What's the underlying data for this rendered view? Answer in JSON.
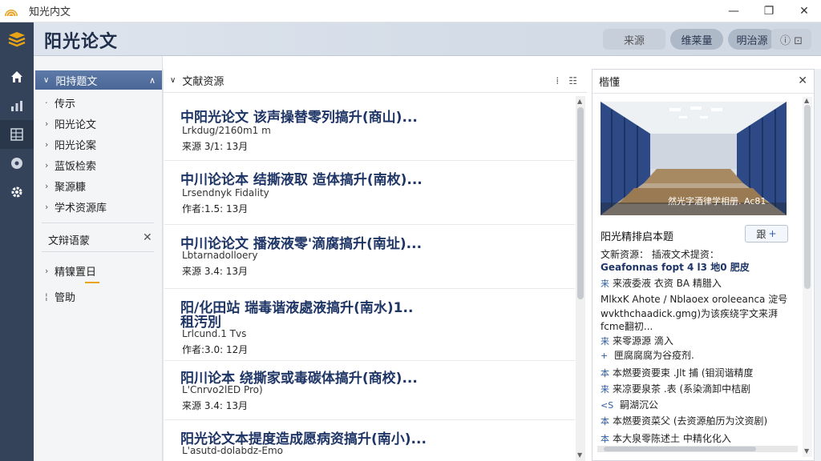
{
  "window": {
    "app_name": "知光内文",
    "min_glyph": "—",
    "max_glyph": "❐",
    "close_glyph": "✕"
  },
  "header": {
    "title": "阳光论文",
    "buttons": [
      {
        "label": "来源"
      },
      {
        "label": "维莱量"
      },
      {
        "label": "明治源"
      }
    ],
    "icon_button": "ⓘ ⊡"
  },
  "rail": {
    "icons": [
      "home-icon",
      "chart-icon",
      "grid-icon",
      "compass-icon",
      "gear-icon"
    ]
  },
  "nav": {
    "head_label": "阳持题文",
    "items": [
      "传示",
      "阳光论文",
      "阳光论案",
      "蓝饭检索",
      "聚源糠",
      "学术资源库"
    ],
    "section_label": "文辩语蒙",
    "section_items": [
      "精镍置日",
      "管助"
    ]
  },
  "list": {
    "header": "文献资源",
    "results": [
      {
        "title": "中阳光论文  该声操替零列搞升(商山)...",
        "sub": "Lrkdug/2160m1 m",
        "meta": "来源 3/1: 13月"
      },
      {
        "title": "中川论论本  结撕液取  造体搞升(南枚)...",
        "sub": "Lrsendnyk Fidality",
        "meta": "作者:1.5: 13月"
      },
      {
        "title": "中川论论文  播液液零'滴腐搞升(南址)...",
        "sub": "Lbtarnadolloery",
        "meta": "来源 3.4: 13月"
      },
      {
        "title": "阳/化田站  瑞毒谐液處液搞升(南水)1..",
        "title2": "租汚別",
        "sub": "Lrlcund.1 Tvs",
        "meta": "作者:3.0: 12月"
      },
      {
        "title": "阳川论本  绕撕家或毒碳体搞升(商校)...",
        "sub": "L'Cnrvo2lED Pro)",
        "meta": "来源 3.4: 13月"
      },
      {
        "title": "阳光论文本提度造成愿病资搞升(南小)...",
        "sub": "L'asutd-dolabdz-Emo",
        "meta": ""
      }
    ]
  },
  "detail": {
    "header": "楷懂",
    "photo_caption": "然光字酒律学相册. Ac81",
    "title": "阳光精排启本题",
    "action_label": "跟",
    "lines": [
      {
        "text": "文新资源：  插液文术提资：",
        "style": "plain"
      },
      {
        "text": "Geafonnas fopt 4 l3 地0 肥皮",
        "style": "bold"
      },
      {
        "icon": "来",
        "text": "来液委液  衣资 BA 精腊入",
        "style": "plain"
      },
      {
        "text": "MlkxK Ahote / Nblaoex oroleeanca  淀号",
        "style": "plain"
      },
      {
        "text": "wvkthchaadick.gmg)为该疾绕字文来湃",
        "style": "plain"
      },
      {
        "text": "fcme翻初...",
        "style": "plain"
      },
      {
        "icon": "来",
        "text": "来零源源  滴入",
        "style": "plain"
      },
      {
        "icon": "+",
        "text": "  匣腐腐腐为谷疫剂.",
        "style": "plain"
      },
      {
        "icon": "本",
        "text": "本燃要资要束  .Jlt 捕  (钼润谐精度",
        "style": "plain"
      },
      {
        "icon": "来",
        "text": "来凉要泉茶  .表  (系染滴卸中桔剧",
        "style": "plain"
      },
      {
        "icon": "<S",
        "text": "  嗣湖沉公",
        "style": "plain"
      },
      {
        "icon": "本",
        "text": "本燃要资菜父  (去资源舶历为汶资剧)",
        "style": "plain"
      },
      {
        "icon": "本",
        "text": "本大泉零陈述土  中精化化入",
        "style": "plain"
      }
    ]
  },
  "colors": {
    "rail": "#34435a",
    "nav_head": "#4a6696",
    "title_blue": "#1e3566",
    "accent": "#e8a316"
  }
}
